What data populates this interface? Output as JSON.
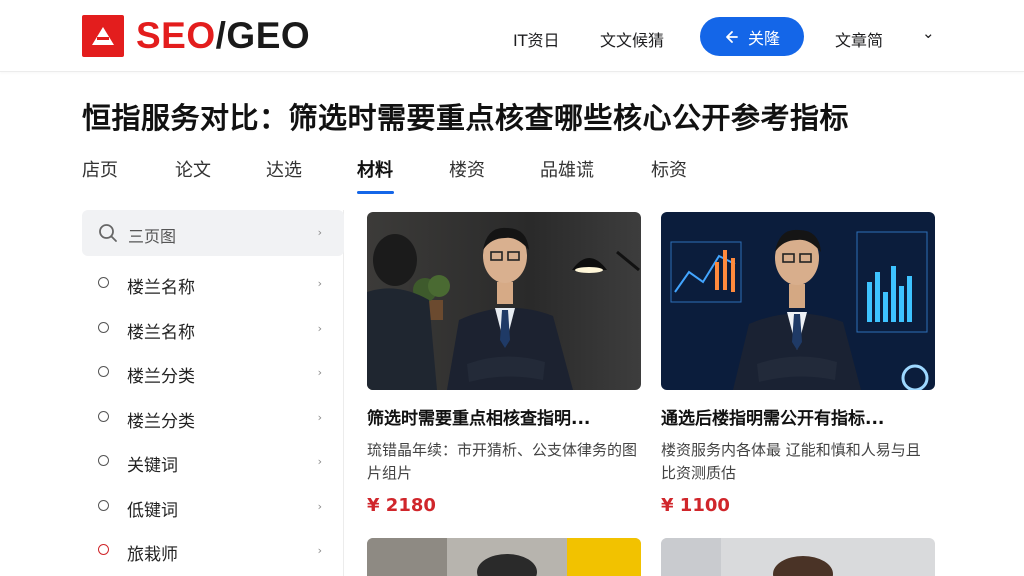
{
  "header": {
    "logo_red": "SEO",
    "logo_dark": "/GEO",
    "nav": [
      "IT资日",
      "文文候猜"
    ],
    "follow_label": "关隆",
    "nav_right": "文章简",
    "more_glyph": "⌄"
  },
  "page_title": "恒指服务对比：筛选时需要重点核查哪些核心公开参考指标",
  "tabs": [
    "店页",
    "论文",
    "达选",
    "材料",
    "楼资",
    "品雄谎",
    "标资"
  ],
  "active_tab_index": 3,
  "sidebar": {
    "search_label": "三页图",
    "items": [
      {
        "label": "楼兰名称"
      },
      {
        "label": "楼兰名称"
      },
      {
        "label": "楼兰分类"
      },
      {
        "label": "楼兰分类"
      },
      {
        "label": "关键词"
      },
      {
        "label": "低键词"
      },
      {
        "label": "旅栽师",
        "active": true
      }
    ],
    "chevron": "›"
  },
  "cards": [
    {
      "title": "筛选时需要重点相核查指明...",
      "desc": "琉错晶年续：市开猜析、公支体律务的图片组片",
      "price": "¥ 2180"
    },
    {
      "title": "通选后楼指明需公开有指标...",
      "desc": "楼资服务内各体最 辽能和慎和人易与且比资测质估",
      "price": "¥ 1100"
    }
  ],
  "colors": {
    "brand_red": "#e31d1d",
    "accent_blue": "#1466e8",
    "price_red": "#d0262b"
  }
}
